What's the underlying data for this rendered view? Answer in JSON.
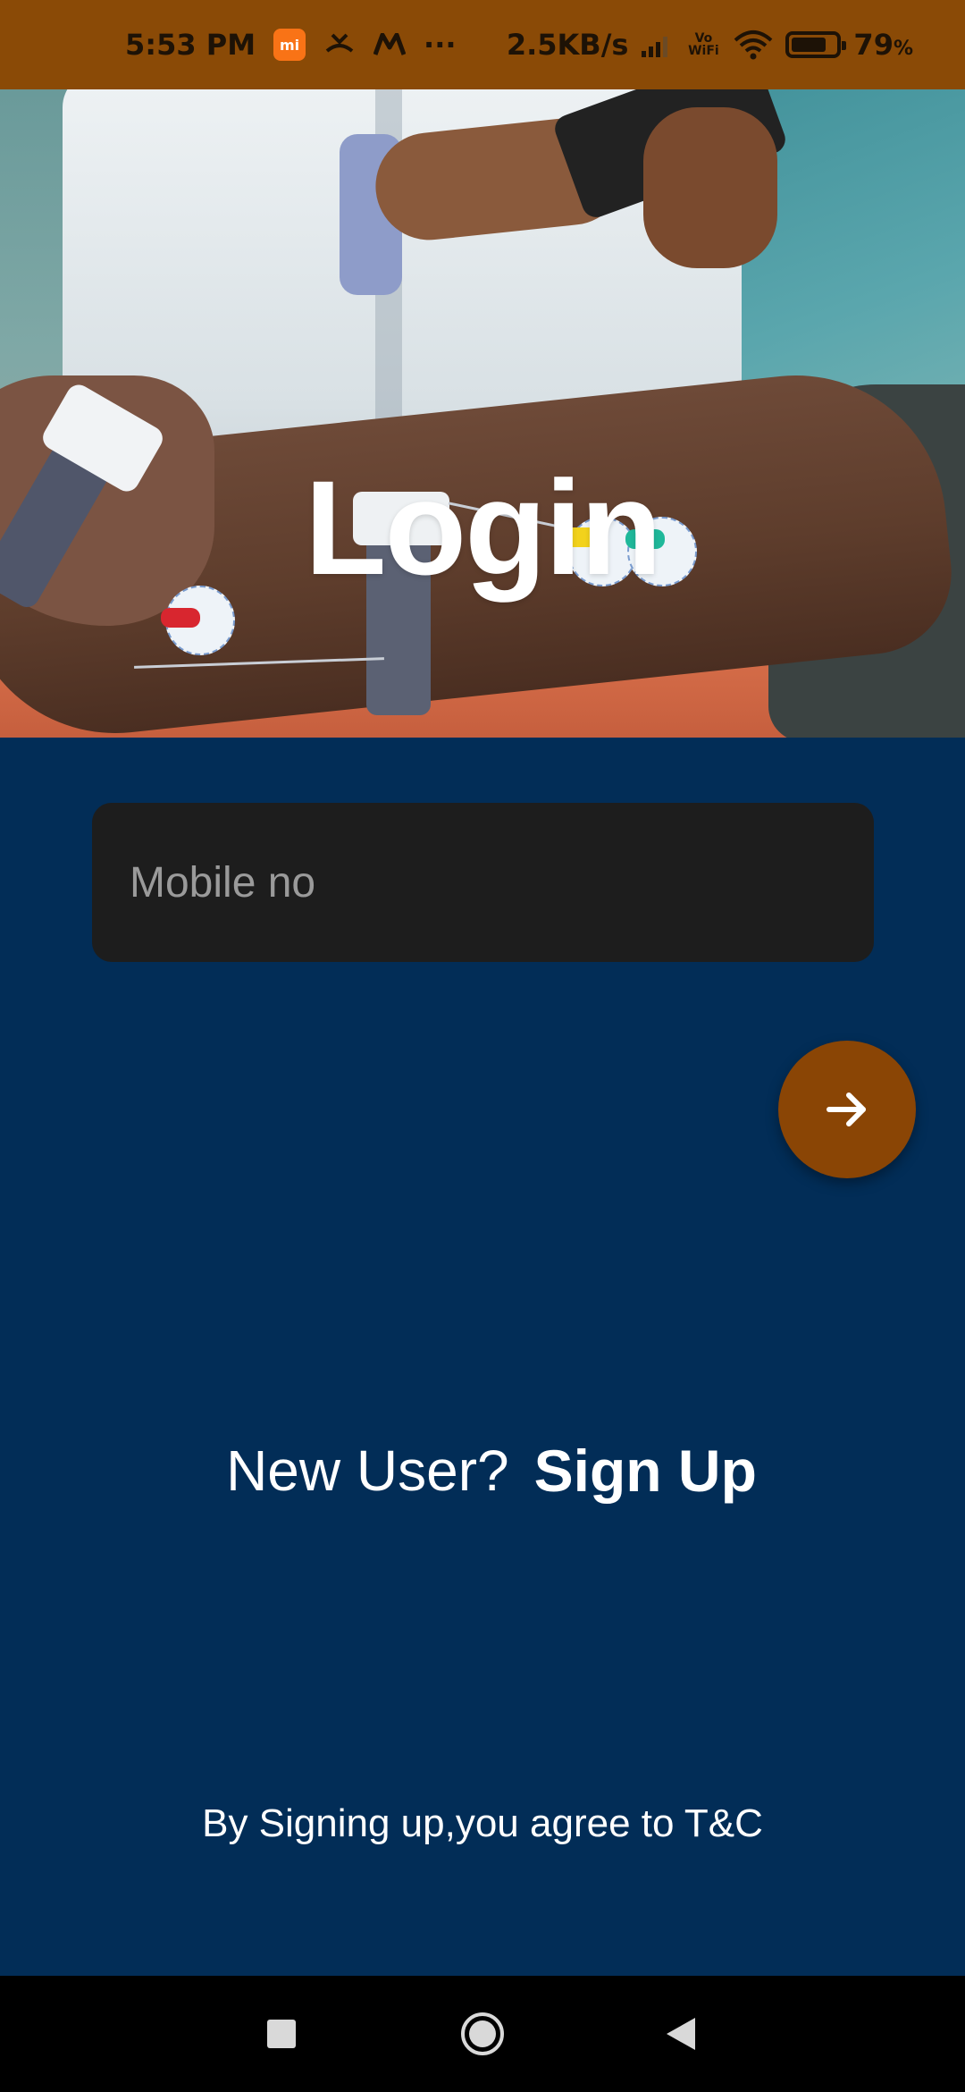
{
  "status_bar": {
    "time": "5:53 PM",
    "mi_badge": "mi",
    "more": "···",
    "net_speed": "2.5KB/s",
    "vowifi": "Vo WiFi",
    "battery_percent": "79",
    "battery_unit": "%",
    "battery_level": 0.79,
    "background_color": "#8a4a06"
  },
  "hero": {
    "title": "Login",
    "image_icon": "ecg-electrodes-on-leg-photo"
  },
  "form": {
    "mobile_placeholder": "Mobile no",
    "mobile_value": "",
    "next_icon": "arrow-right-icon",
    "accent_color": "#8a4505"
  },
  "signup": {
    "prompt": "New User?",
    "link": "Sign Up"
  },
  "terms": {
    "text": "By Signing up,you agree to T&C"
  },
  "nav_bar": {
    "recents_icon": "square-recents-icon",
    "home_icon": "circle-home-icon",
    "back_icon": "triangle-back-icon"
  },
  "theme": {
    "background": "#022d57",
    "input_background": "#1d1d1d"
  }
}
